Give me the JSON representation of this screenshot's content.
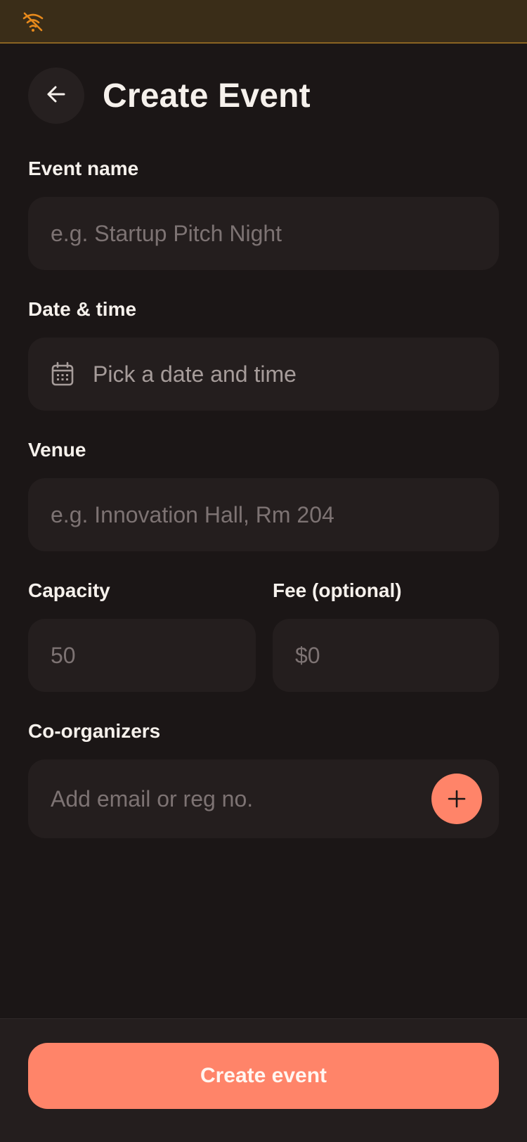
{
  "header": {
    "title": "Create Event",
    "back_icon": "arrow-left-icon"
  },
  "status_bar": {
    "icon": "wifi-off-icon",
    "icon_color": "#e6891c"
  },
  "form": {
    "event_name": {
      "label": "Event name",
      "placeholder": "e.g. Startup Pitch Night",
      "value": ""
    },
    "date_time": {
      "label": "Date & time",
      "placeholder": "Pick a date and time",
      "icon": "calendar-icon"
    },
    "venue": {
      "label": "Venue",
      "placeholder": "e.g. Innovation Hall, Rm 204",
      "value": ""
    },
    "capacity": {
      "label": "Capacity",
      "placeholder": "50",
      "value": ""
    },
    "fee": {
      "label": "Fee (optional)",
      "placeholder": "$0",
      "value": ""
    },
    "co_organizers": {
      "label": "Co-organizers",
      "placeholder": "Add email or reg no.",
      "value": "",
      "add_icon": "plus-icon"
    }
  },
  "footer": {
    "create_label": "Create event"
  },
  "colors": {
    "accent": "#ff8469",
    "background": "#1b1616",
    "field": "#241e1e",
    "status_bar": "#3a2d18"
  }
}
